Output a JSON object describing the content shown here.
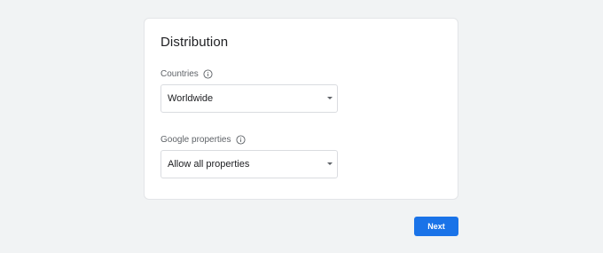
{
  "card": {
    "title": "Distribution"
  },
  "fields": {
    "countries": {
      "label": "Countries",
      "value": "Worldwide",
      "icon": "info-icon"
    },
    "google_properties": {
      "label": "Google properties",
      "value": "Allow all properties",
      "icon": "info-icon"
    }
  },
  "actions": {
    "next_label": "Next"
  },
  "colors": {
    "background": "#f1f3f4",
    "primary": "#1a73e8",
    "label_text": "#5f6368"
  }
}
